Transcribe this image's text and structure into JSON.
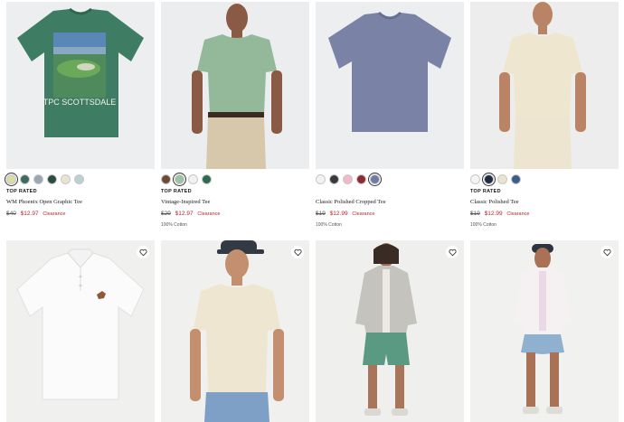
{
  "products": [
    {
      "badge": "TOP RATED",
      "name": "WM Phoenix Open Graphic Tee",
      "old_price": "$40",
      "new_price": "$12.97",
      "clearance": "Clearance",
      "material": "",
      "graphic_text": "TPC SCOTTSDALE",
      "swatches": [
        "#d9dca3",
        "#3d6b5e",
        "#9aa7b3",
        "#2e4a42",
        "#e8e4d4",
        "#b9d1cf"
      ]
    },
    {
      "badge": "TOP RATED",
      "name": "Vintage-Inspired Tee",
      "old_price": "$29",
      "new_price": "$12.97",
      "clearance": "Clearance",
      "material": "100% Cotton",
      "swatches": [
        "#6b4a36",
        "#9ec2a2",
        "#f1f1ef",
        "#2f6b53"
      ]
    },
    {
      "badge": "",
      "name": "Classic Polished Cropped Tee",
      "old_price": "$19",
      "new_price": "$12.99",
      "clearance": "Clearance",
      "material": "100% Cotton",
      "swatches": [
        "#f2f2f2",
        "#3a3a3a",
        "#f0b9c6",
        "#8e2a33",
        "#6f7ba3"
      ]
    },
    {
      "badge": "TOP RATED",
      "name": "Classic Polished Tee",
      "old_price": "$19",
      "new_price": "$12.99",
      "clearance": "Clearance",
      "material": "100% Cotton",
      "swatches": [
        "#f4f4f2",
        "#1f2a44",
        "#e9e3cf",
        "#3f5a8a"
      ]
    }
  ],
  "second_row": [
    {
      "alt": "White polo shirt"
    },
    {
      "alt": "Model in cream tee and denim shorts"
    },
    {
      "alt": "Model in grey zip hoodie and green shorts"
    },
    {
      "alt": "Model in white oxford shirt and blue shorts"
    }
  ],
  "colors": {
    "clearance_red": "#b7242b",
    "image_bg": "#eceeef"
  },
  "icons": {
    "wishlist": "heart-outline-icon"
  }
}
